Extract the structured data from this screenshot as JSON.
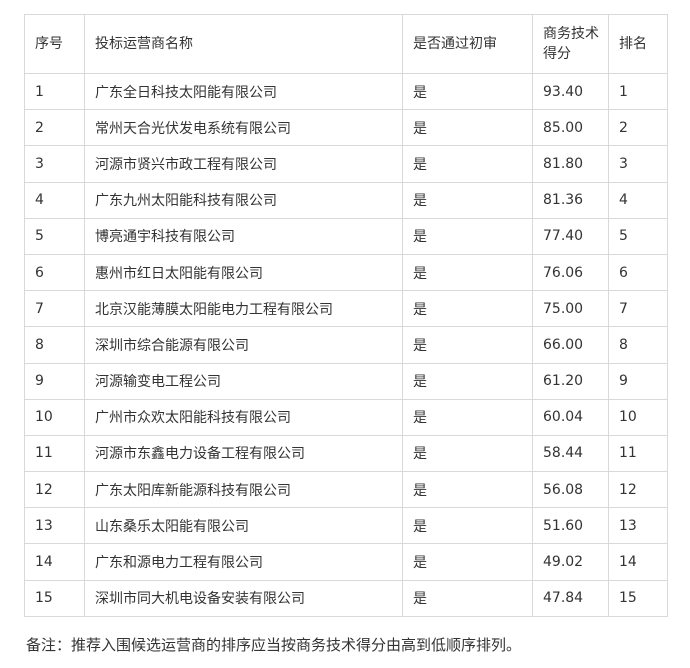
{
  "table": {
    "headers": [
      "序号",
      "投标运营商名称",
      "是否通过初审",
      "商务技术得分",
      "排名"
    ],
    "rows": [
      [
        "1",
        "广东全日科技太阳能有限公司",
        "是",
        "93.40",
        "1"
      ],
      [
        "2",
        "常州天合光伏发电系统有限公司",
        "是",
        "85.00",
        "2"
      ],
      [
        "3",
        "河源市贤兴市政工程有限公司",
        "是",
        "81.80",
        "3"
      ],
      [
        "4",
        "广东九州太阳能科技有限公司",
        "是",
        "81.36",
        "4"
      ],
      [
        "5",
        "博亮通宇科技有限公司",
        "是",
        "77.40",
        "5"
      ],
      [
        "6",
        "惠州市红日太阳能有限公司",
        "是",
        "76.06",
        "6"
      ],
      [
        "7",
        "北京汉能薄膜太阳能电力工程有限公司",
        "是",
        "75.00",
        "7"
      ],
      [
        "8",
        "深圳市综合能源有限公司",
        "是",
        "66.00",
        "8"
      ],
      [
        "9",
        "河源输变电工程公司",
        "是",
        "61.20",
        "9"
      ],
      [
        "10",
        "广州市众欢太阳能科技有限公司",
        "是",
        "60.04",
        "10"
      ],
      [
        "11",
        "河源市东鑫电力设备工程有限公司",
        "是",
        "58.44",
        "11"
      ],
      [
        "12",
        "广东太阳库新能源科技有限公司",
        "是",
        "56.08",
        "12"
      ],
      [
        "13",
        "山东桑乐太阳能有限公司",
        "是",
        "51.60",
        "13"
      ],
      [
        "14",
        "广东和源电力工程有限公司",
        "是",
        "49.02",
        "14"
      ],
      [
        "15",
        "深圳市同大机电设备安装有限公司",
        "是",
        "47.84",
        "15"
      ]
    ]
  },
  "note": "备注：推荐入围候选运营商的排序应当按商务技术得分由高到低顺序排列。",
  "colors": {
    "border": "#d9d9d9",
    "text": "#333333",
    "background": "#ffffff"
  }
}
